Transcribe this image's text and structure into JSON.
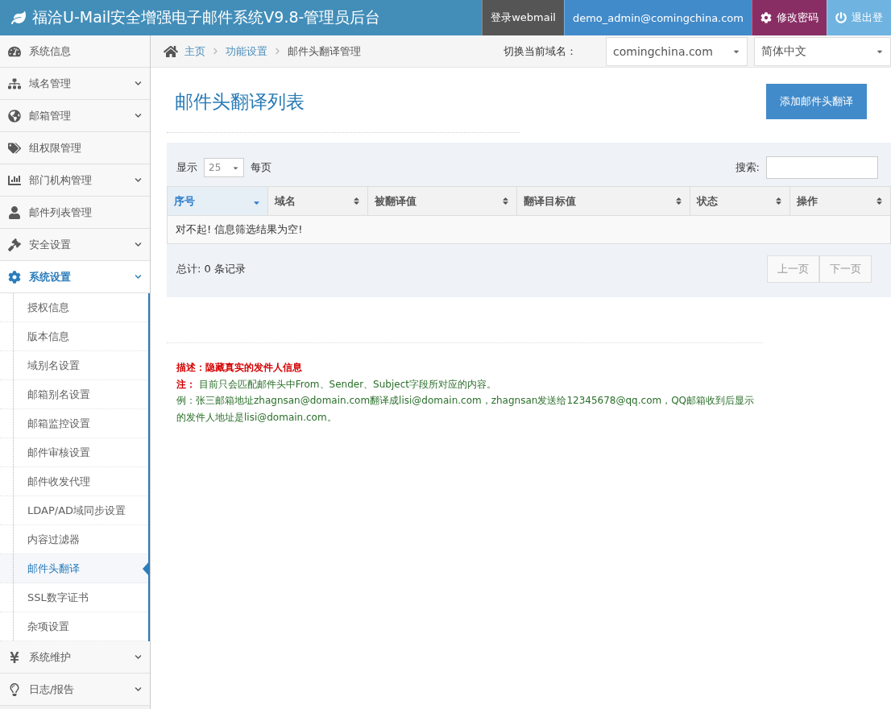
{
  "header": {
    "title": "福洽U-Mail安全增强电子邮件系统V9.8-管理员后台",
    "actions": [
      {
        "label": "登录webmail",
        "kind": "webmail"
      },
      {
        "label": "demo_admin@comingchina.com",
        "kind": "account"
      },
      {
        "label": "修改密码",
        "kind": "password"
      },
      {
        "label": "退出登",
        "kind": "logout"
      }
    ]
  },
  "sidebar": {
    "items": [
      {
        "label": "系统信息",
        "expandable": false,
        "selected": false
      },
      {
        "label": "域名管理",
        "expandable": true,
        "selected": false
      },
      {
        "label": "邮箱管理",
        "expandable": true,
        "selected": false
      },
      {
        "label": "组权限管理",
        "expandable": false,
        "selected": false
      },
      {
        "label": "部门机构管理",
        "expandable": true,
        "selected": false
      },
      {
        "label": "邮件列表管理",
        "expandable": false,
        "selected": false
      },
      {
        "label": "安全设置",
        "expandable": true,
        "selected": false
      },
      {
        "label": "系统设置",
        "expandable": true,
        "selected": true,
        "children": [
          {
            "label": "授权信息",
            "selected": false
          },
          {
            "label": "版本信息",
            "selected": false
          },
          {
            "label": "域别名设置",
            "selected": false
          },
          {
            "label": "邮箱别名设置",
            "selected": false
          },
          {
            "label": "邮箱监控设置",
            "selected": false
          },
          {
            "label": "邮件审核设置",
            "selected": false
          },
          {
            "label": "邮件收发代理",
            "selected": false
          },
          {
            "label": "LDAP/AD域同步设置",
            "selected": false
          },
          {
            "label": "内容过滤器",
            "selected": false
          },
          {
            "label": "邮件头翻译",
            "selected": true
          },
          {
            "label": "SSL数字证书",
            "selected": false
          },
          {
            "label": "杂项设置",
            "selected": false
          }
        ]
      },
      {
        "label": "系统维护",
        "expandable": true,
        "selected": false
      },
      {
        "label": "日志/报告",
        "expandable": true,
        "selected": false
      }
    ]
  },
  "breadcrumb": [
    "主页",
    "功能设置",
    "邮件头翻译管理"
  ],
  "domain_switch": {
    "label": "切换当前域名：",
    "domain": "comingchina.com",
    "language": "简体中文"
  },
  "page_title": "邮件头翻译列表",
  "add_button": "添加邮件头翻译",
  "table_controls": {
    "show_label": "显示",
    "page_size": "25",
    "per_page_label": "每页",
    "search_label": "搜索:"
  },
  "table": {
    "columns": [
      {
        "label": "序号",
        "selected": true
      },
      {
        "label": "域名",
        "selected": false
      },
      {
        "label": "被翻译值",
        "selected": false
      },
      {
        "label": "翻译目标值",
        "selected": false
      },
      {
        "label": "状态",
        "selected": false
      },
      {
        "label": "操作",
        "selected": false
      }
    ],
    "empty_message": "对不起! 信息筛选结果为空!"
  },
  "footer": {
    "total": "总计: 0 条记录",
    "prev": "上一页",
    "next": "下一页"
  },
  "notes": [
    {
      "kind": "title",
      "text": "描述：隐藏真实的发件人信息"
    },
    {
      "kind": "text",
      "text": "**注：** 目前只会匹配邮件头中From、Sender、Subject字段所对应的内容。"
    },
    {
      "kind": "text",
      "text": "例：张三邮箱地址zhagnsan@domain.com翻译成lisi@domain.com，zhagnsan发送给12345678@qq.com，QQ邮箱收到后显示的发件人地址是lisi@domain.com。"
    }
  ]
}
